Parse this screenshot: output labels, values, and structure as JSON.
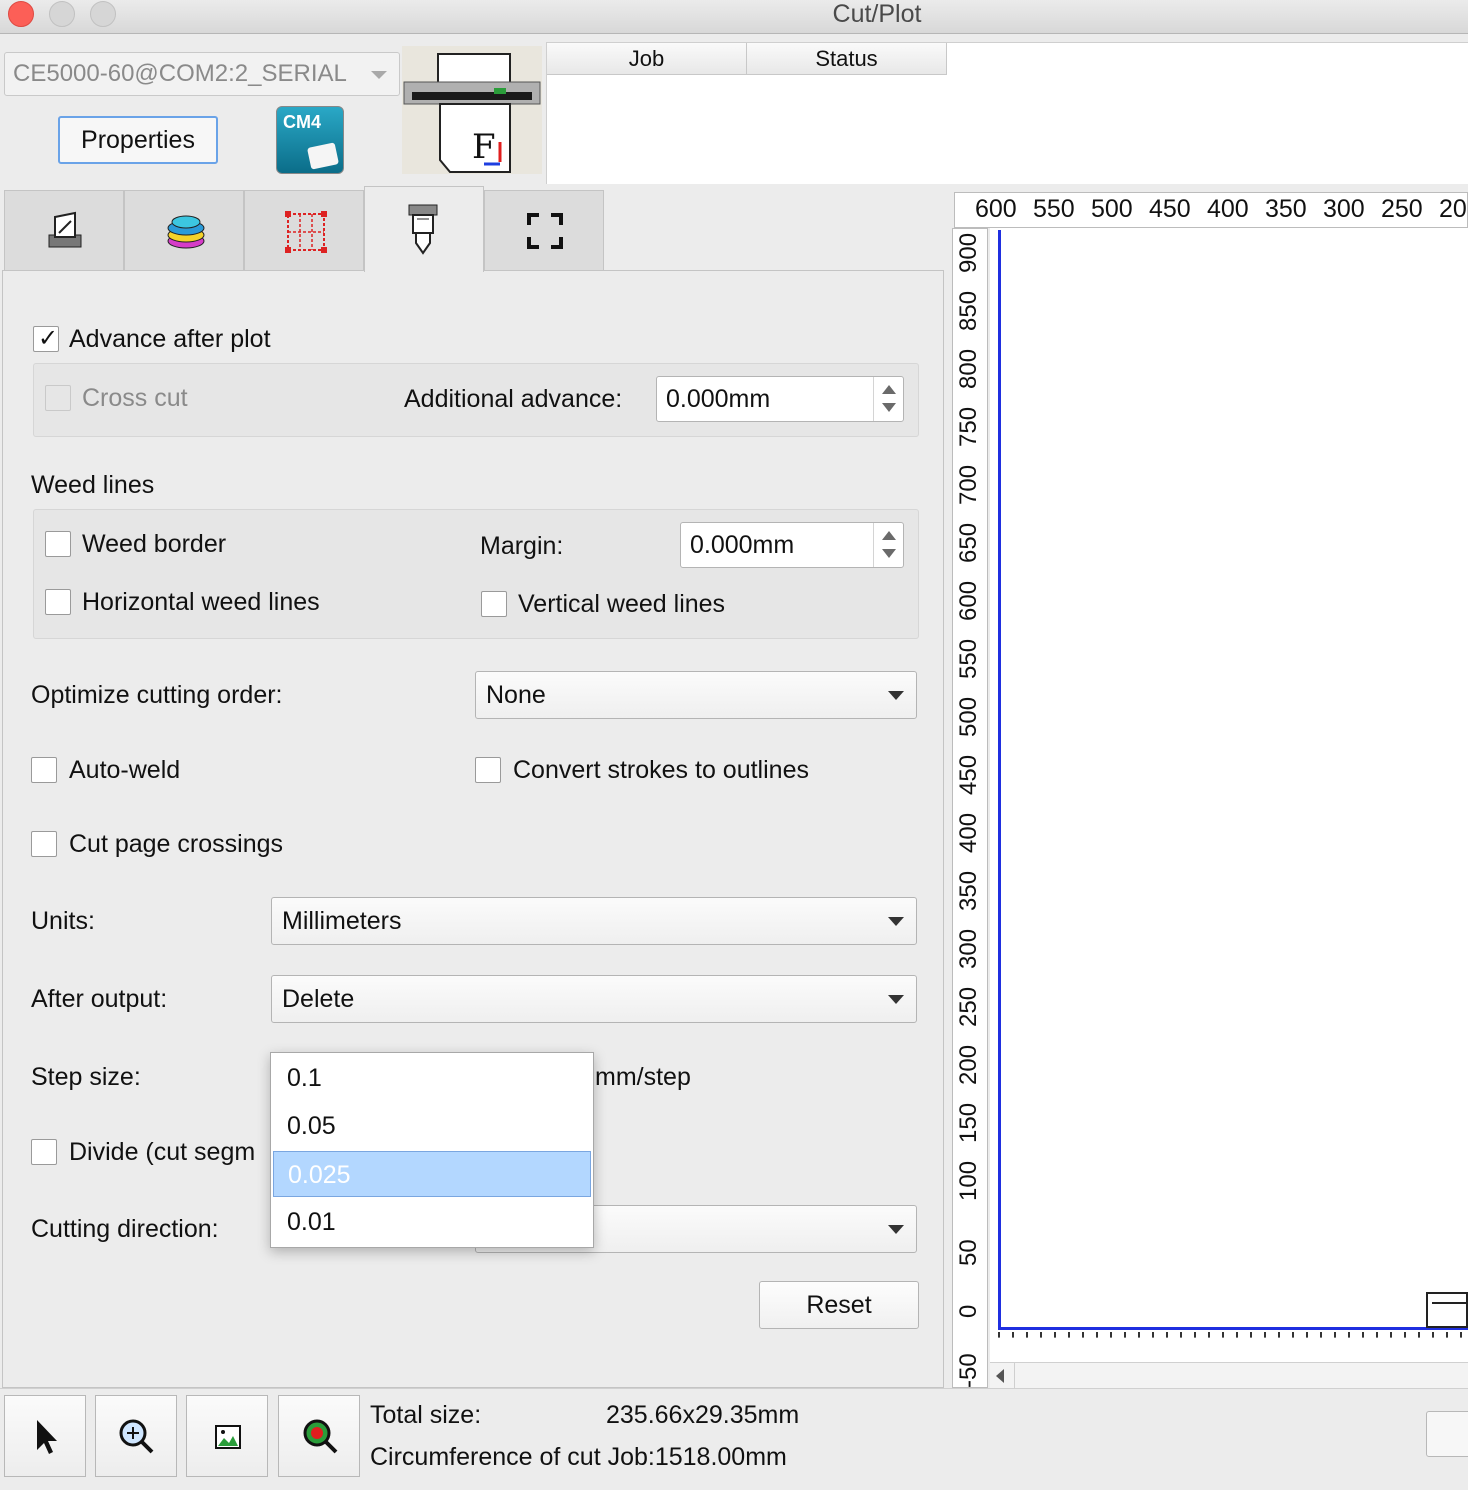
{
  "window": {
    "title": "Cut/Plot"
  },
  "device": {
    "selected": "CE5000-60@COM2:2_SERIAL",
    "properties_label": "Properties",
    "cm4_label": "CM4"
  },
  "jobs": {
    "columns": [
      "Job",
      "Status"
    ]
  },
  "tabs": [
    {
      "name": "general",
      "icon": "plotter-page-icon"
    },
    {
      "name": "layers",
      "icon": "layers-icon"
    },
    {
      "name": "tiling",
      "icon": "tiling-grid-icon"
    },
    {
      "name": "options",
      "icon": "cutter-knife-icon",
      "active": true
    },
    {
      "name": "marks",
      "icon": "registration-marks-icon"
    }
  ],
  "options": {
    "advance_after_plot": {
      "label": "Advance after plot",
      "checked": true
    },
    "cross_cut": {
      "label": "Cross cut",
      "checked": false,
      "enabled": false
    },
    "additional_advance": {
      "label": "Additional advance:",
      "value": "0.000mm"
    },
    "weed_lines": {
      "heading": "Weed lines",
      "weed_border": {
        "label": "Weed border",
        "checked": false
      },
      "margin": {
        "label": "Margin:",
        "value": "0.000mm"
      },
      "horizontal": {
        "label": "Horizontal weed lines",
        "checked": false
      },
      "vertical": {
        "label": "Vertical weed lines",
        "checked": false
      }
    },
    "optimize": {
      "label": "Optimize cutting order:",
      "value": "None"
    },
    "auto_weld": {
      "label": "Auto-weld",
      "checked": false
    },
    "convert_strokes": {
      "label": "Convert strokes to outlines",
      "checked": false
    },
    "cut_page_crossings": {
      "label": "Cut page crossings",
      "checked": false
    },
    "units": {
      "label": "Units:",
      "value": "Millimeters"
    },
    "after_output": {
      "label": "After output:",
      "value": "Delete"
    },
    "step_size": {
      "label": "Step size:",
      "unit": "mm/step",
      "options": [
        "0.1",
        "0.05",
        "0.025",
        "0.01"
      ],
      "selected": "0.025"
    },
    "divide": {
      "label": "Divide (cut segm",
      "checked": false
    },
    "cutting_direction": {
      "label": "Cutting direction:"
    },
    "reset_label": "Reset"
  },
  "ruler": {
    "horizontal": [
      "600",
      "550",
      "500",
      "450",
      "400",
      "350",
      "300",
      "250",
      "20"
    ],
    "vertical": [
      "900",
      "850",
      "800",
      "750",
      "700",
      "650",
      "600",
      "550",
      "500",
      "450",
      "400",
      "350",
      "300",
      "250",
      "200",
      "150",
      "100",
      "50",
      "0",
      "-50"
    ]
  },
  "status": {
    "total_size_label": "Total size:",
    "total_size_value": "235.66x29.35mm",
    "circumference": "Circumference of cut Job:1518.00mm"
  },
  "toolbar": [
    {
      "name": "select-tool",
      "icon": "arrow-pointer-icon"
    },
    {
      "name": "zoom-in-tool",
      "icon": "zoom-in-icon"
    },
    {
      "name": "preview-tool",
      "icon": "image-preview-icon"
    },
    {
      "name": "zoom-fit-tool",
      "icon": "zoom-fit-icon"
    }
  ],
  "colors": {
    "accent": "#6aa3e8",
    "selection": "#b3d7ff",
    "canvas_border": "#1f2fe0"
  }
}
